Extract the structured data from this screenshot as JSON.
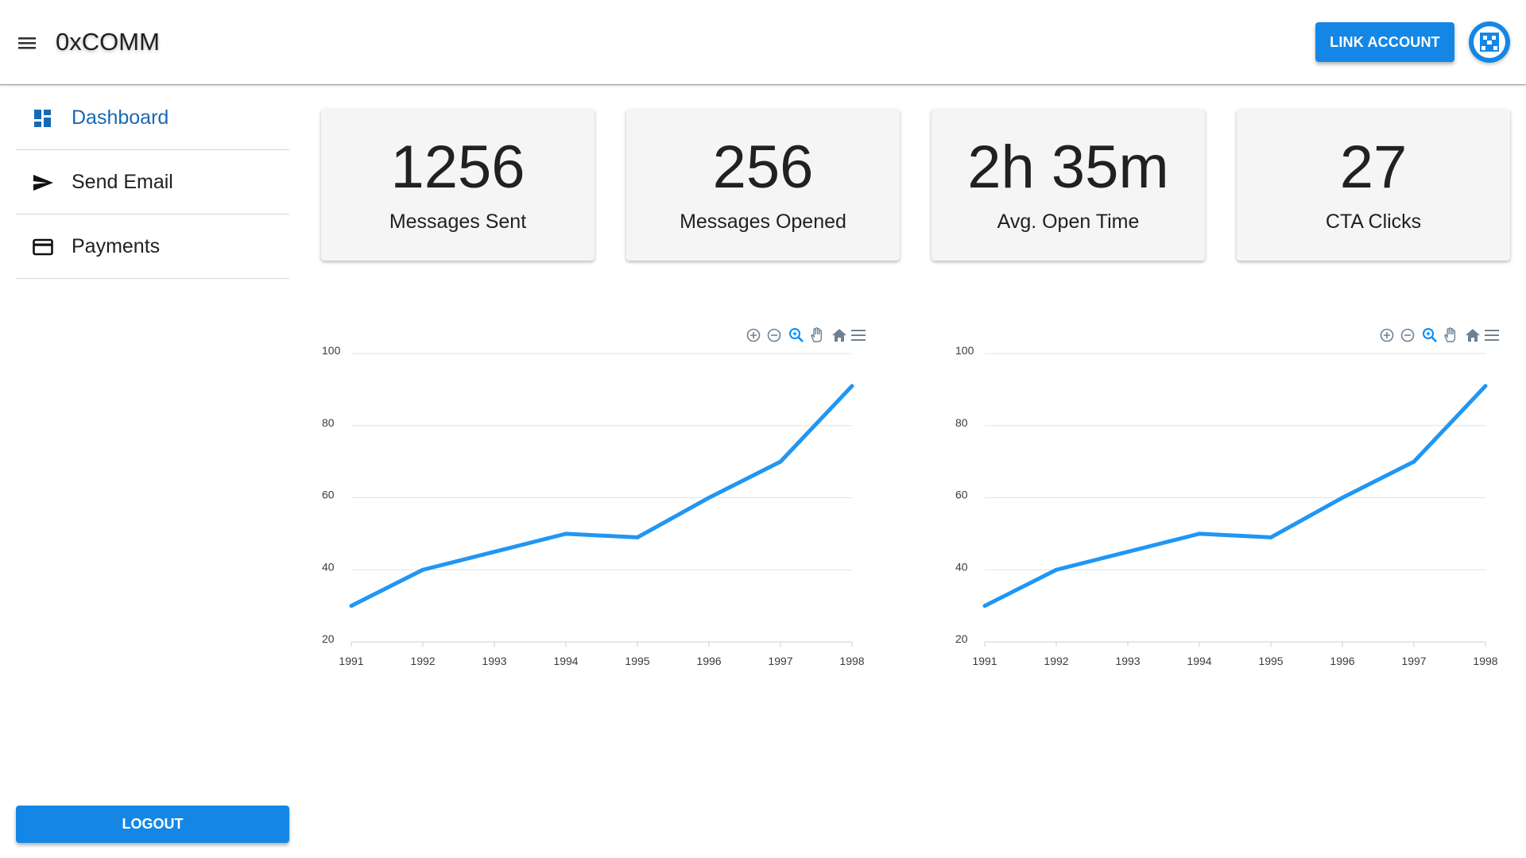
{
  "appbar": {
    "title": "0xCOMM",
    "link_account_label": "LINK ACCOUNT",
    "menu_icon": "menu-icon",
    "avatar_icon": "avatar-icon"
  },
  "sidebar": {
    "items": [
      {
        "label": "Dashboard",
        "icon": "dashboard-icon",
        "active": true
      },
      {
        "label": "Send Email",
        "icon": "send-icon",
        "active": false
      },
      {
        "label": "Payments",
        "icon": "credit-card-icon",
        "active": false
      }
    ],
    "logout_label": "LOGOUT"
  },
  "stats": [
    {
      "value": "1256",
      "label": "Messages Sent"
    },
    {
      "value": "256",
      "label": "Messages Opened"
    },
    {
      "value": "2h 35m",
      "label": "Avg. Open Time"
    },
    {
      "value": "27",
      "label": "CTA Clicks"
    }
  ],
  "colors": {
    "accent": "#1487e6",
    "active_nav": "#1769b5",
    "series_line": "#2196f3",
    "card_bg": "#f5f5f5"
  },
  "chart_toolbar_icons": [
    "zoom-in-icon",
    "zoom-out-icon",
    "selection-zoom-icon",
    "pan-hand-icon",
    "reset-home-icon",
    "menu-icon"
  ],
  "chart_data": [
    {
      "type": "line",
      "x": [
        "1991",
        "1992",
        "1993",
        "1994",
        "1995",
        "1996",
        "1997",
        "1998"
      ],
      "series": [
        {
          "values": [
            30,
            40,
            45,
            50,
            49,
            60,
            70,
            91
          ]
        }
      ],
      "ylim": [
        20,
        100
      ],
      "yticks": [
        20,
        40,
        60,
        80,
        100
      ],
      "grid": true,
      "title": "",
      "xlabel": "",
      "ylabel": ""
    },
    {
      "type": "line",
      "x": [
        "1991",
        "1992",
        "1993",
        "1994",
        "1995",
        "1996",
        "1997",
        "1998"
      ],
      "series": [
        {
          "values": [
            30,
            40,
            45,
            50,
            49,
            60,
            70,
            91
          ]
        }
      ],
      "ylim": [
        20,
        100
      ],
      "yticks": [
        20,
        40,
        60,
        80,
        100
      ],
      "grid": true,
      "title": "",
      "xlabel": "",
      "ylabel": ""
    }
  ]
}
